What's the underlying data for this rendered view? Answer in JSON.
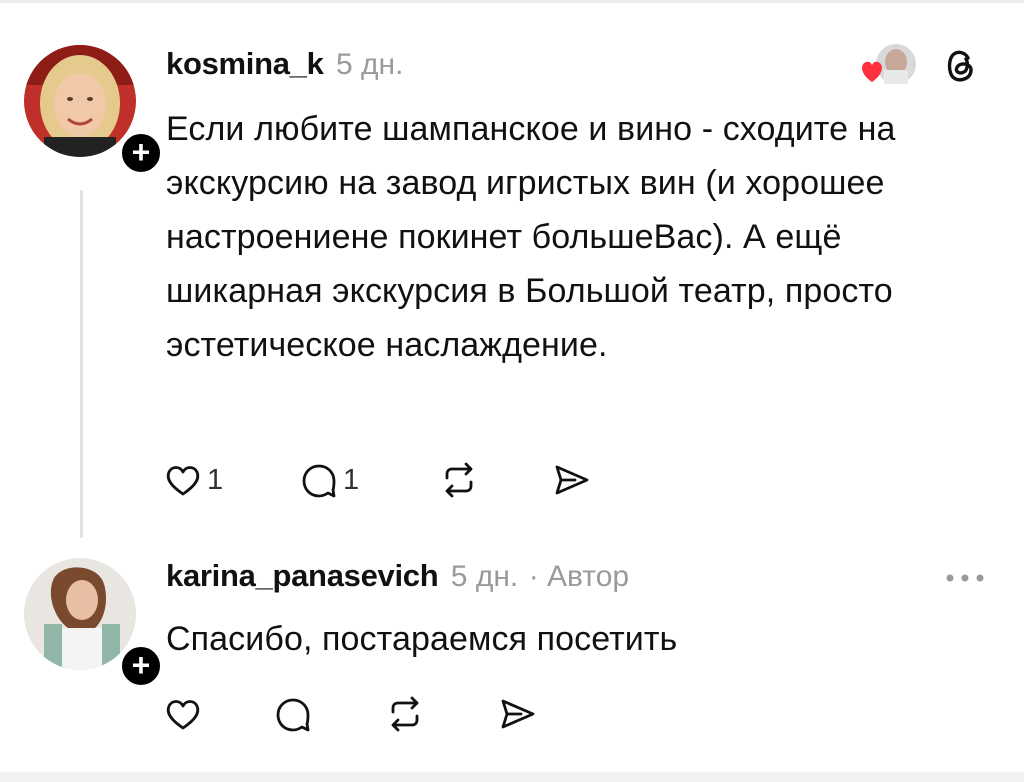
{
  "posts": [
    {
      "username": "kosmina_k",
      "time": "5 дн.",
      "author_tag": "",
      "text": "Если любите шампанское и вино - сходите на экскурсию на завод игристых вин (и хорошее настроениене покинет большеВас). А ещё шикарная экскурсия в Большой театр, просто эстетическое наслаждение.",
      "like_count": "1",
      "reply_count": "1",
      "follow_symbol": "+"
    },
    {
      "username": "karina_panasevich",
      "time": "5 дн.",
      "author_tag": "· Автор",
      "text": "Спасибо, постараемся посетить",
      "like_count": "",
      "reply_count": "",
      "follow_symbol": "+"
    }
  ],
  "colors": {
    "liked_heart": "#ff3040",
    "meta_gray": "#9a9a9a",
    "text": "#111111",
    "badge": "#000000"
  },
  "icons": [
    "heart-icon",
    "comment-icon",
    "repost-icon",
    "share-icon",
    "threads-logo-icon",
    "more-icon",
    "liked-heart-icon"
  ]
}
